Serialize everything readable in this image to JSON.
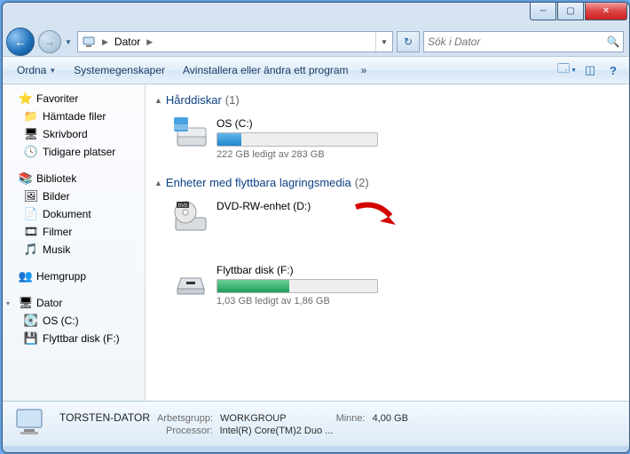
{
  "title": "Dator",
  "address": {
    "location": "Dator"
  },
  "search": {
    "placeholder": "Sök i Dator"
  },
  "toolbar": {
    "organize": "Ordna",
    "sysprops": "Systemegenskaper",
    "uninstall": "Avinstallera eller ändra ett program",
    "chev": "»"
  },
  "sidebar": {
    "fav": {
      "head": "Favoriter",
      "items": [
        "Hämtade filer",
        "Skrivbord",
        "Tidigare platser"
      ]
    },
    "lib": {
      "head": "Bibliotek",
      "items": [
        "Bilder",
        "Dokument",
        "Filmer",
        "Musik"
      ]
    },
    "home": {
      "head": "Hemgrupp"
    },
    "pc": {
      "head": "Dator",
      "items": [
        "OS (C:)",
        "Flyttbar disk (F:)"
      ]
    }
  },
  "groups": {
    "hdd": {
      "title": "Hårddiskar",
      "count": "(1)"
    },
    "rem": {
      "title": "Enheter med flyttbara lagringsmedia",
      "count": "(2)"
    }
  },
  "drives": {
    "c": {
      "name": "OS (C:)",
      "free": "222 GB ledigt av 283 GB",
      "pct": 15
    },
    "d": {
      "name": "DVD-RW-enhet (D:)"
    },
    "f": {
      "name": "Flyttbar disk (F:)",
      "free": "1,03 GB ledigt av 1,86 GB",
      "pct": 45
    }
  },
  "status": {
    "computer": "TORSTEN-DATOR",
    "workgroup_lbl": "Arbetsgrupp:",
    "workgroup": "WORKGROUP",
    "mem_lbl": "Minne:",
    "mem": "4,00 GB",
    "cpu_lbl": "Processor:",
    "cpu": "Intel(R) Core(TM)2 Duo ..."
  }
}
